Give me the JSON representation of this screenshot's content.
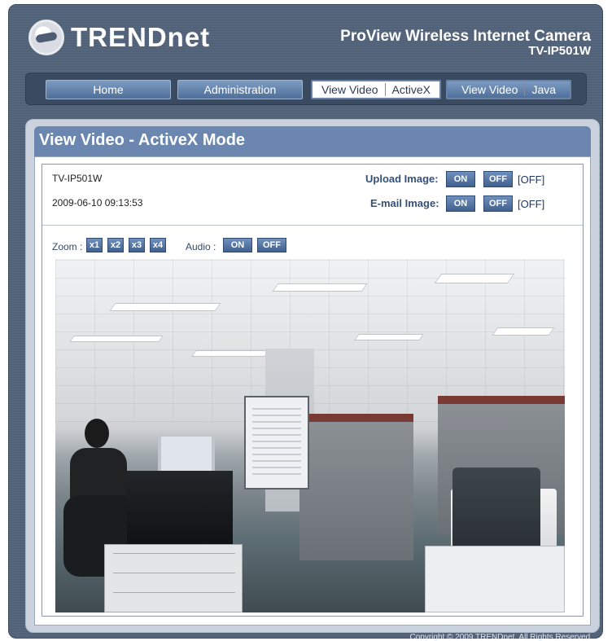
{
  "brand": {
    "logo_text": "TRENDnet",
    "product_line": "ProView Wireless Internet Camera",
    "model": "TV-IP501W"
  },
  "nav": {
    "home": "Home",
    "administration": "Administration",
    "view_video_activex": {
      "label": "View Video",
      "mode": "ActiveX"
    },
    "view_video_java": {
      "label": "View Video",
      "mode": "Java"
    }
  },
  "panel": {
    "title": "View Video - ActiveX Mode"
  },
  "camera": {
    "name": "TV-IP501W",
    "timestamp": "2009-06-10 09:13:53"
  },
  "upload_image": {
    "label": "Upload Image:",
    "on": "ON",
    "off": "OFF",
    "state": "[OFF]"
  },
  "email_image": {
    "label": "E-mail Image:",
    "on": "ON",
    "off": "OFF",
    "state": "[OFF]"
  },
  "zoom": {
    "label": "Zoom :",
    "options": [
      "x1",
      "x2",
      "x3",
      "x4"
    ]
  },
  "audio": {
    "label": "Audio :",
    "on": "ON",
    "off": "OFF"
  },
  "footer": {
    "copyright": "Copyright © 2009 TRENDnet. All Rights Reserved."
  }
}
